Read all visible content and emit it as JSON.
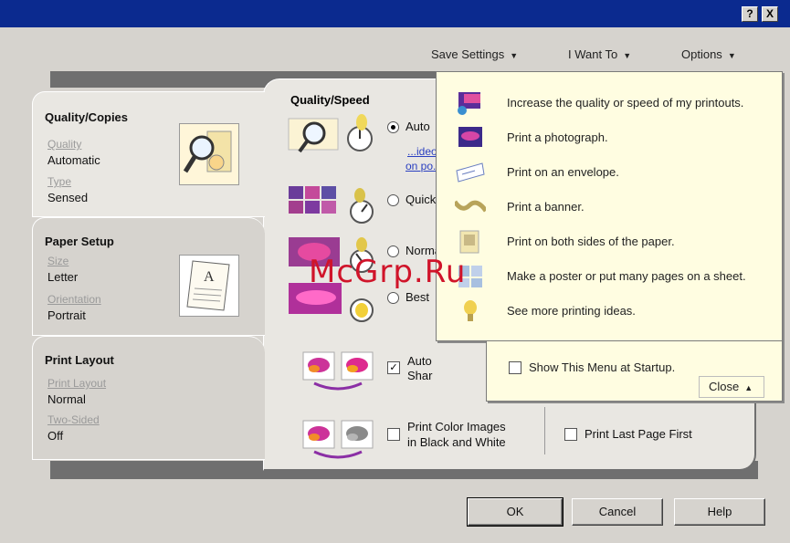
{
  "title_buttons": {
    "help": "?",
    "close": "X"
  },
  "menu": {
    "save_settings": "Save Settings",
    "i_want_to": "I Want To",
    "options": "Options"
  },
  "tabs": [
    {
      "title": "Quality/Copies",
      "fields": [
        {
          "label": "Quality",
          "value": "Automatic"
        },
        {
          "label": "Type",
          "value": "Sensed"
        }
      ]
    },
    {
      "title": "Paper Setup",
      "fields": [
        {
          "label": "Size",
          "value": "Letter"
        },
        {
          "label": "Orientation",
          "value": "Portrait"
        }
      ]
    },
    {
      "title": "Print Layout",
      "fields": [
        {
          "label": "Print Layout",
          "value": "Normal"
        },
        {
          "label": "Two-Sided",
          "value": "Off"
        }
      ]
    }
  ],
  "quality": {
    "title": "Quality/Speed",
    "options": [
      "Auto",
      "Quick",
      "Normal",
      "Best"
    ],
    "selected": 0,
    "links": [
      "...ideo",
      "on po..."
    ],
    "auto_sharpen_label": [
      "Auto",
      "Shar"
    ],
    "bw_label": [
      "Print Color Images",
      "in Black and White"
    ],
    "last_page_label": "Print Last Page First"
  },
  "dropdown": {
    "items": [
      {
        "icon": "quality-speed-icon",
        "label": "Increase the quality or speed of my printouts."
      },
      {
        "icon": "photo-icon",
        "label": "Print a photograph."
      },
      {
        "icon": "envelope-icon",
        "label": "Print on an envelope."
      },
      {
        "icon": "banner-icon",
        "label": "Print a banner."
      },
      {
        "icon": "two-sided-icon",
        "label": "Print on both sides of the paper."
      },
      {
        "icon": "poster-icon",
        "label": "Make a poster or put many pages on a sheet."
      },
      {
        "icon": "ideas-icon",
        "label": "See more printing ideas."
      }
    ],
    "show_at_startup": "Show This Menu at Startup.",
    "close": "Close"
  },
  "buttons": {
    "ok": "OK",
    "cancel": "Cancel",
    "help": "Help"
  },
  "watermark": "McGrp.Ru",
  "colors": {
    "titlebar": "#0b2a8f",
    "face": "#d6d3ce",
    "menu_bg": "#fffde1"
  }
}
